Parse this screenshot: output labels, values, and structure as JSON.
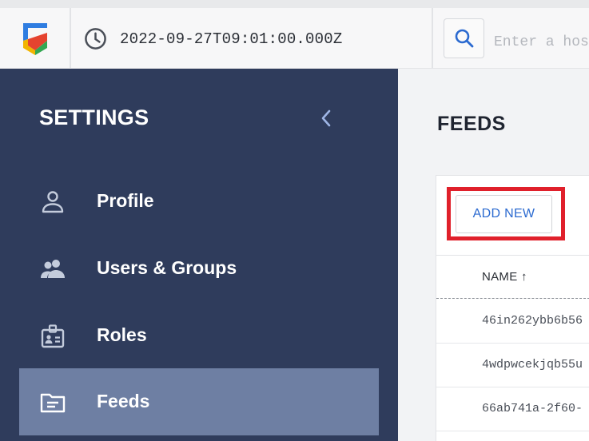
{
  "topbar": {
    "timestamp": "2022-09-27T09:01:00.000Z",
    "search_placeholder": "Enter a host"
  },
  "sidebar": {
    "title": "SETTINGS",
    "items": [
      {
        "label": "Profile",
        "icon": "person-icon",
        "active": false
      },
      {
        "label": "Users & Groups",
        "icon": "users-icon",
        "active": false
      },
      {
        "label": "Roles",
        "icon": "badge-icon",
        "active": false
      },
      {
        "label": "Feeds",
        "icon": "folder-icon",
        "active": true
      }
    ]
  },
  "main": {
    "title": "FEEDS",
    "add_button_label": "ADD NEW",
    "table": {
      "column_name": "NAME ↑",
      "rows": [
        {
          "name": "46in262ybb6b56"
        },
        {
          "name": "4wdpwcekjqb55u"
        },
        {
          "name": "66ab741a-2f60-"
        }
      ]
    }
  },
  "colors": {
    "sidebar_bg": "#2f3c5c",
    "sidebar_active": "#6e7fa3",
    "accent": "#2b6ad0",
    "highlight": "#e0202b"
  }
}
